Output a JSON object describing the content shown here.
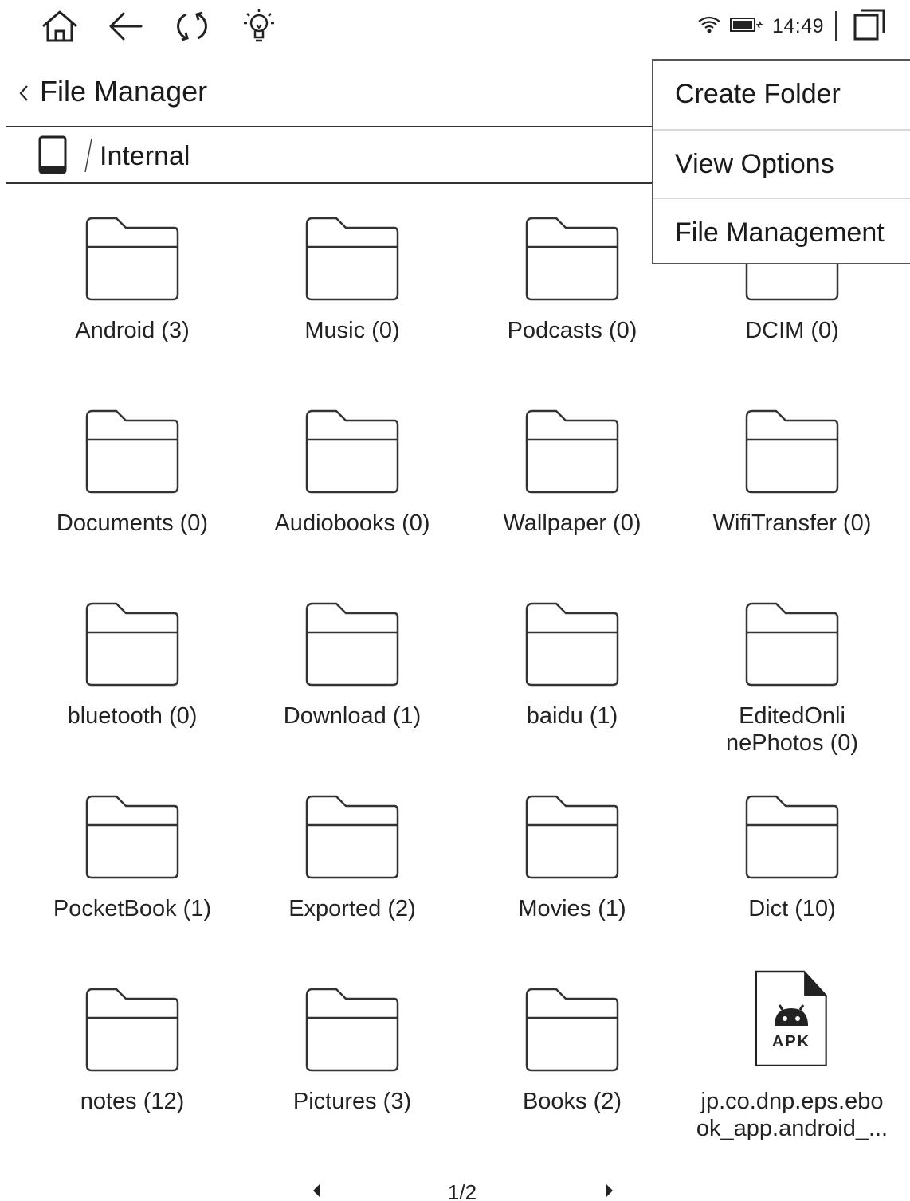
{
  "status_bar": {
    "clock": "14:49",
    "left_icons": [
      "home-icon",
      "back-arrow-icon",
      "refresh-icon",
      "lightbulb-icon"
    ],
    "right_icons": [
      "wifi-icon",
      "battery-charging-icon",
      "multitask-icon"
    ]
  },
  "header": {
    "title": "File Manager",
    "path": "Internal"
  },
  "menu": {
    "items": [
      {
        "label": "Create Folder"
      },
      {
        "label": "View Options"
      },
      {
        "label": "File Management"
      }
    ]
  },
  "files": {
    "items": [
      {
        "label": "Android (3)",
        "type": "folder"
      },
      {
        "label": "Music (0)",
        "type": "folder"
      },
      {
        "label": "Podcasts (0)",
        "type": "folder"
      },
      {
        "label": "DCIM (0)",
        "type": "folder"
      },
      {
        "label": "Documents (0)",
        "type": "folder"
      },
      {
        "label": "Audiobooks (0)",
        "type": "folder"
      },
      {
        "label": "Wallpaper (0)",
        "type": "folder"
      },
      {
        "label": "WifiTransfer (0)",
        "type": "folder"
      },
      {
        "label": "bluetooth (0)",
        "type": "folder"
      },
      {
        "label": "Download (1)",
        "type": "folder"
      },
      {
        "label": "baidu (1)",
        "type": "folder"
      },
      {
        "label": "EditedOnli\nnePhotos (0)",
        "type": "folder"
      },
      {
        "label": "PocketBook (1)",
        "type": "folder"
      },
      {
        "label": "Exported (2)",
        "type": "folder"
      },
      {
        "label": "Movies (1)",
        "type": "folder"
      },
      {
        "label": "Dict (10)",
        "type": "folder"
      },
      {
        "label": "notes (12)",
        "type": "folder"
      },
      {
        "label": "Pictures (3)",
        "type": "folder"
      },
      {
        "label": "Books (2)",
        "type": "folder"
      },
      {
        "label": "jp.co.dnp.eps.ebo\nok_app.android_...",
        "type": "apk",
        "badge": "APK"
      }
    ]
  },
  "pagination": {
    "text": "1/2"
  }
}
